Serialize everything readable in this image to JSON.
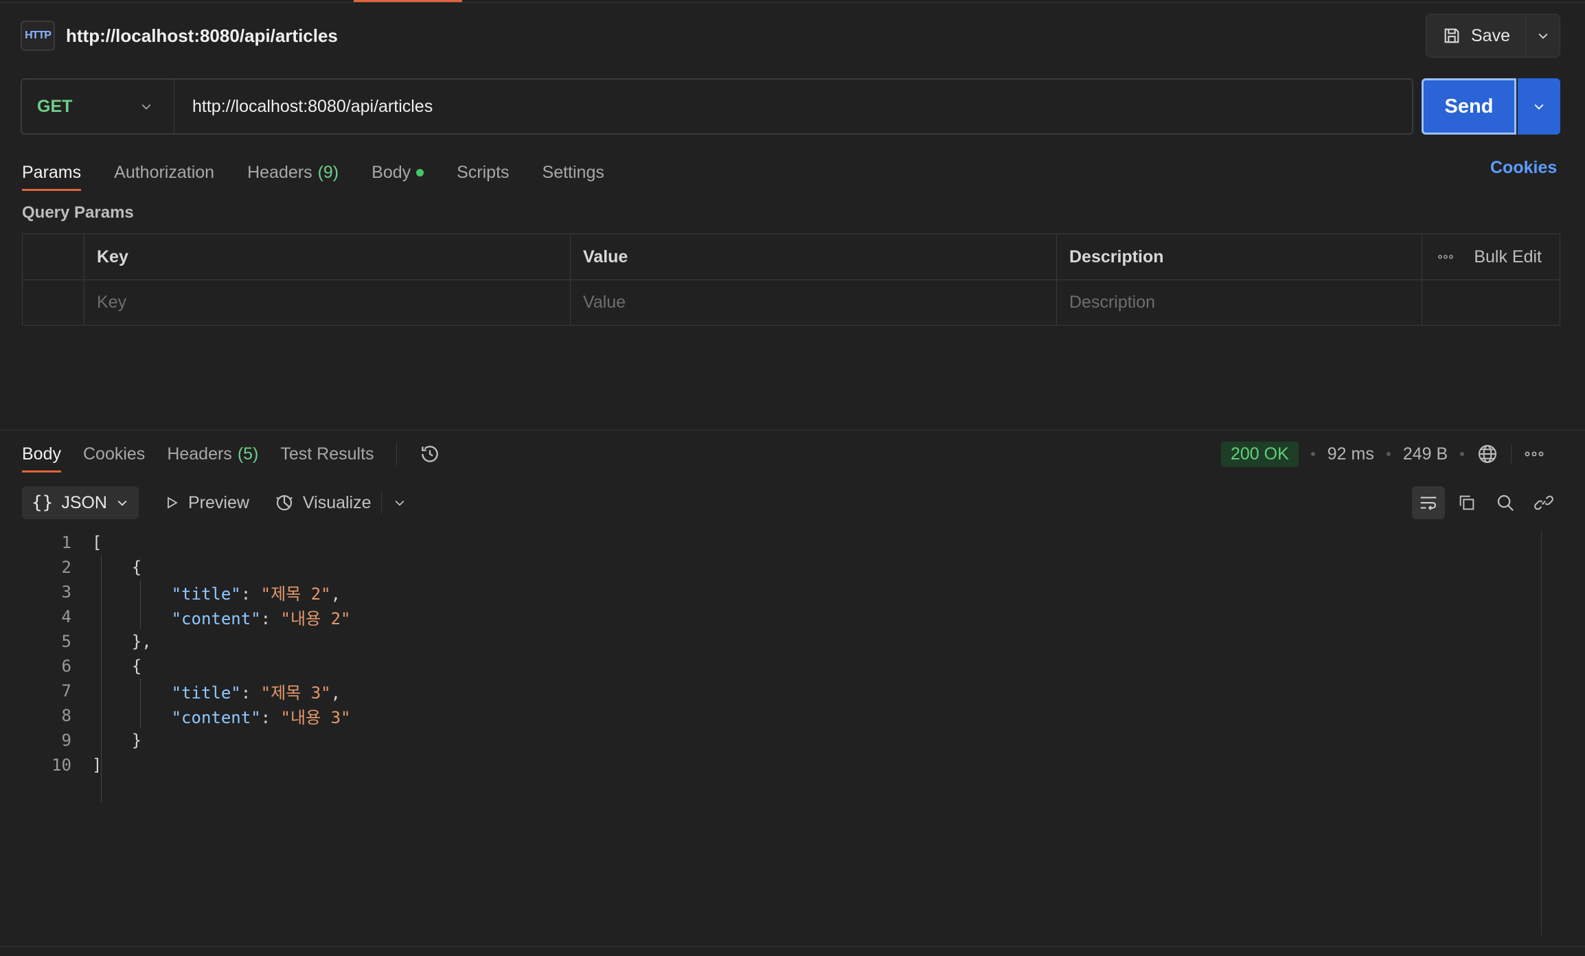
{
  "request": {
    "badge": "HTTP",
    "title": "http://localhost:8080/api/articles",
    "save_label": "Save",
    "method": "GET",
    "url": "http://localhost:8080/api/articles",
    "send_label": "Send",
    "tabs": [
      {
        "label": "Params"
      },
      {
        "label": "Authorization"
      },
      {
        "label": "Headers",
        "count": "(9)"
      },
      {
        "label": "Body"
      },
      {
        "label": "Scripts"
      },
      {
        "label": "Settings"
      }
    ],
    "cookies_label": "Cookies",
    "query_params_label": "Query Params",
    "params_table": {
      "headers": [
        "Key",
        "Value",
        "Description"
      ],
      "bulk_edit": "Bulk Edit",
      "placeholders": [
        "Key",
        "Value",
        "Description"
      ]
    }
  },
  "response": {
    "tabs": [
      {
        "label": "Body"
      },
      {
        "label": "Cookies"
      },
      {
        "label": "Headers",
        "count": "(5)"
      },
      {
        "label": "Test Results"
      }
    ],
    "status": "200 OK",
    "time": "92 ms",
    "size": "249 B",
    "format": "JSON",
    "preview_label": "Preview",
    "visualize_label": "Visualize",
    "code_lines": [
      {
        "n": "1",
        "text": "["
      },
      {
        "n": "2",
        "text": "    {"
      },
      {
        "n": "3",
        "key": "\"title\"",
        "value": "\"제목 2\"",
        "trail": ","
      },
      {
        "n": "4",
        "key": "\"content\"",
        "value": "\"내용 2\"",
        "trail": ""
      },
      {
        "n": "5",
        "text": "    },"
      },
      {
        "n": "6",
        "text": "    {"
      },
      {
        "n": "7",
        "key": "\"title\"",
        "value": "\"제목 3\"",
        "trail": ","
      },
      {
        "n": "8",
        "key": "\"content\"",
        "value": "\"내용 3\"",
        "trail": ""
      },
      {
        "n": "9",
        "text": "    }"
      },
      {
        "n": "10",
        "text": "]"
      }
    ]
  },
  "colors": {
    "accent": "#e0643a",
    "send": "#2a64d6",
    "method": "#6fcf8b",
    "link": "#5b9dff",
    "status_ok": "#5ed27b"
  }
}
